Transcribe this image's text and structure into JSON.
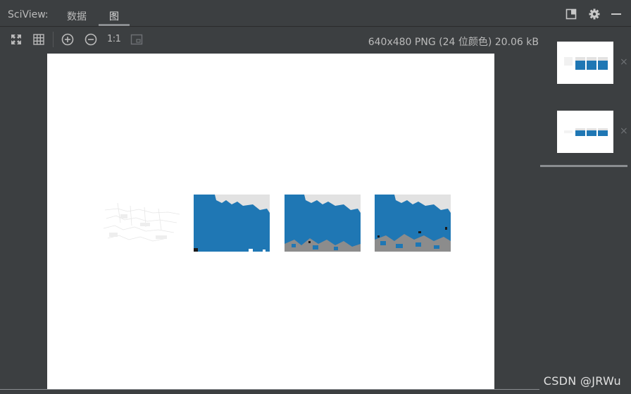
{
  "header": {
    "app_title": "SciView:",
    "tabs": [
      {
        "label": "数据",
        "active": false
      },
      {
        "label": "图",
        "active": true
      }
    ],
    "icons": [
      "layout-panel-icon",
      "gear-icon",
      "minimize-icon"
    ]
  },
  "toolbar": {
    "buttons": [
      "fit-to-window-icon",
      "grid-icon",
      "zoom-in-icon",
      "zoom-out-icon",
      "actual-size-icon",
      "background-toggle-icon"
    ],
    "actual_size_label": "1:1",
    "image_info": "640x480 PNG (24 位颜色) 20.06 kB"
  },
  "plot": {
    "subplots": [
      {
        "name": "original-image"
      },
      {
        "name": "segmentation-1"
      },
      {
        "name": "segmentation-2"
      },
      {
        "name": "segmentation-3"
      }
    ],
    "colors": {
      "segment": "#1f77b4",
      "sky": "#e2e2e2",
      "ground": "#8c8c8c",
      "dark": "#2a2a2a"
    }
  },
  "sidebar": {
    "thumbnails": [
      {
        "close": "×"
      },
      {
        "close": "×"
      }
    ]
  },
  "watermark": "CSDN @JRWu"
}
